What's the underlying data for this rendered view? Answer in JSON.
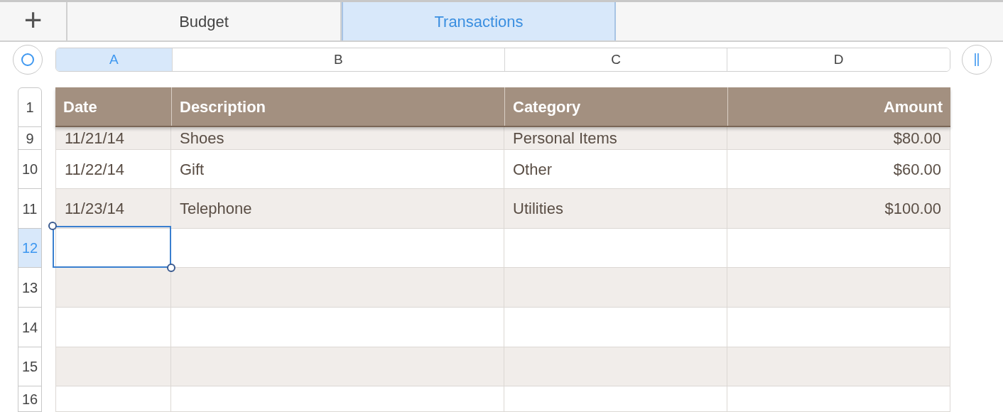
{
  "add_button": {
    "label": "+"
  },
  "tabs": [
    {
      "label": "Budget",
      "selected": false
    },
    {
      "label": "Transactions",
      "selected": true
    }
  ],
  "column_letters": [
    {
      "label": "A",
      "selected": true
    },
    {
      "label": "B",
      "selected": false
    },
    {
      "label": "C",
      "selected": false
    },
    {
      "label": "D",
      "selected": false
    }
  ],
  "table": {
    "header_row": "1",
    "columns": [
      "Date",
      "Description",
      "Category",
      "Amount"
    ],
    "rows": [
      {
        "number": "9",
        "selected": false,
        "cells": [
          "11/21/14",
          "Shoes",
          "Personal Items",
          "$80.00"
        ]
      },
      {
        "number": "10",
        "selected": false,
        "cells": [
          "11/22/14",
          "Gift",
          "Other",
          "$60.00"
        ]
      },
      {
        "number": "11",
        "selected": false,
        "cells": [
          "11/23/14",
          "Telephone",
          "Utilities",
          "$100.00"
        ]
      },
      {
        "number": "12",
        "selected": true
      },
      {
        "number": "13",
        "selected": false
      },
      {
        "number": "14",
        "selected": false
      },
      {
        "number": "15",
        "selected": false
      },
      {
        "number": "16",
        "selected": false
      }
    ]
  }
}
